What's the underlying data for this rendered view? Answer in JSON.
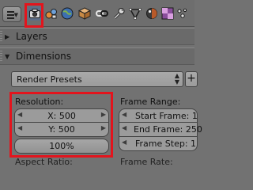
{
  "toolbar": {
    "editor_type_icon": "properties-editor-icon",
    "tabs": [
      {
        "name": "render",
        "icon": "camera-icon",
        "active": true
      },
      {
        "name": "scene",
        "icon": "scene-icon",
        "active": false
      },
      {
        "name": "world",
        "icon": "world-icon",
        "active": false
      },
      {
        "name": "object",
        "icon": "cube-icon",
        "active": false
      },
      {
        "name": "constraints",
        "icon": "chain-link-icon",
        "active": false
      },
      {
        "name": "modifiers",
        "icon": "wrench-icon",
        "active": false
      },
      {
        "name": "data",
        "icon": "mesh-data-icon",
        "active": false
      },
      {
        "name": "material",
        "icon": "material-sphere-icon",
        "active": false
      }
    ]
  },
  "panels": {
    "layers": {
      "title": "Layers",
      "collapsed": true
    },
    "dimensions": {
      "title": "Dimensions",
      "collapsed": false
    }
  },
  "presets": {
    "label": "Render Presets",
    "add_label": "+"
  },
  "resolution": {
    "label": "Resolution:",
    "x": "X: 500",
    "y": "Y: 500",
    "percentage": "100%"
  },
  "frame_range": {
    "label": "Frame Range:",
    "start": "Start Frame: 1",
    "end": "End Frame: 250",
    "step": "Frame Step: 1"
  },
  "aspect_ratio_label": "Aspect Ratio:",
  "frame_rate_label": "Frame Rate:",
  "colors": {
    "highlight": "#e3141d",
    "active_tab": "#5d6e87",
    "panel_bg": "#727272"
  }
}
